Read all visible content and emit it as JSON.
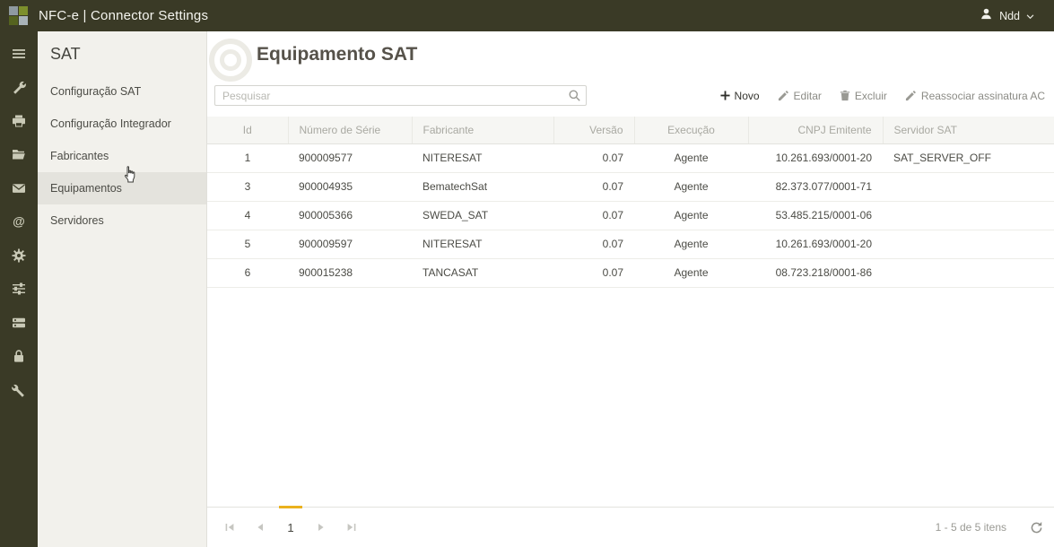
{
  "topbar": {
    "title": "NFC-e | Connector Settings",
    "user": "Ndd"
  },
  "rail": {
    "icons": [
      "menu",
      "wrench",
      "printer",
      "folder-open",
      "mail",
      "at-sign",
      "gear",
      "sliders",
      "print-queue",
      "lock",
      "tools"
    ]
  },
  "sidebar": {
    "title": "SAT",
    "items": [
      {
        "label": "Configuração SAT",
        "selected": false
      },
      {
        "label": "Configuração Integrador",
        "selected": false
      },
      {
        "label": "Fabricantes",
        "selected": false
      },
      {
        "label": "Equipamentos",
        "selected": true
      },
      {
        "label": "Servidores",
        "selected": false
      }
    ]
  },
  "main": {
    "title": "Equipamento SAT",
    "search": {
      "placeholder": "Pesquisar"
    },
    "toolbar": {
      "new": "Novo",
      "edit": "Editar",
      "delete": "Excluir",
      "reassign": "Reassociar assinatura AC"
    },
    "table": {
      "columns": [
        "Id",
        "Número de Série",
        "Fabricante",
        "Versão",
        "Execução",
        "CNPJ Emitente",
        "Servidor SAT"
      ],
      "rows": [
        [
          "1",
          "900009577",
          "NITERESAT",
          "0.07",
          "Agente",
          "10.261.693/0001-20",
          "SAT_SERVER_OFF"
        ],
        [
          "3",
          "900004935",
          "BematechSat",
          "0.07",
          "Agente",
          "82.373.077/0001-71",
          ""
        ],
        [
          "4",
          "900005366",
          "SWEDA_SAT",
          "0.07",
          "Agente",
          "53.485.215/0001-06",
          ""
        ],
        [
          "5",
          "900009597",
          "NITERESAT",
          "0.07",
          "Agente",
          "10.261.693/0001-20",
          ""
        ],
        [
          "6",
          "900015238",
          "TANCASAT",
          "0.07",
          "Agente",
          "08.723.218/0001-86",
          ""
        ]
      ]
    },
    "pager": {
      "page": "1",
      "status": "1 - 5 de 5 itens"
    }
  },
  "colors": {
    "topbar_bg": "#3a3a26",
    "accent": "#eab11e",
    "selected_item_bg": "#e4e3dd"
  }
}
